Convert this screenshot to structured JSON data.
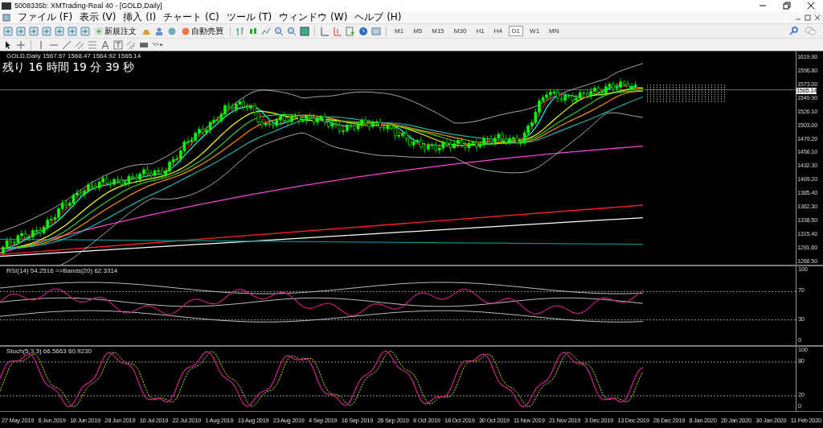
{
  "window": {
    "title": "5008335b: XMTrading-Real 40 - [GOLD,Daily]"
  },
  "menu": [
    "ファイル (F)",
    "表示 (V)",
    "挿入 (I)",
    "チャート (C)",
    "ツール (T)",
    "ウィンドウ (W)",
    "ヘルプ (H)"
  ],
  "toolbar": {
    "new_order": "新規注文",
    "auto_trading": "自動売買"
  },
  "timeframes": [
    {
      "label": "M1",
      "selected": false
    },
    {
      "label": "M5",
      "selected": false
    },
    {
      "label": "M15",
      "selected": false
    },
    {
      "label": "M30",
      "selected": false
    },
    {
      "label": "H1",
      "selected": false
    },
    {
      "label": "H4",
      "selected": false
    },
    {
      "label": "D1",
      "selected": true
    },
    {
      "label": "W1",
      "selected": false
    },
    {
      "label": "MN",
      "selected": false
    }
  ],
  "chart": {
    "header": "GOLD,Daily  1567.67 1568.47 1564.92 1565.14",
    "countdown": "残り 16 時間 19 分 39 秒",
    "current_price": "1565.14",
    "price_ticks": [
      "1619.90",
      "1596.80",
      "1573.00",
      "1549.90",
      "1526.10",
      "1503.00",
      "1479.20",
      "1456.10",
      "1432.30",
      "1409.20",
      "1385.40",
      "1362.30",
      "1338.50",
      "1315.40",
      "1291.60",
      "1268.50"
    ]
  },
  "rsi": {
    "label": "RSI(14) 54.2516  =>Bands(20) 62.3314",
    "ticks": [
      "100",
      "70",
      "30",
      "0"
    ]
  },
  "stoch": {
    "label": "Stoch(5,3,3) 66.5663 60.9230",
    "ticks": [
      "100",
      "80",
      "20",
      "0"
    ]
  },
  "dates": [
    "27 May 2019",
    "6 Jun 2019",
    "18 Jun 2019",
    "28 Jun 2019",
    "10 Jul 2019",
    "22 Jul 2019",
    "1 Aug 2019",
    "13 Aug 2019",
    "23 Aug 2019",
    "4 Sep 2019",
    "16 Sep 2019",
    "26 Sep 2019",
    "8 Oct 2019",
    "18 Oct 2019",
    "30 Oct 2019",
    "11 Nov 2019",
    "21 Nov 2019",
    "3 Dec 2019",
    "13 Dec 2019",
    "26 Dec 2019",
    "8 Jan 2020",
    "20 Jan 2020",
    "30 Jan 2020",
    "11 Feb 2020"
  ]
}
